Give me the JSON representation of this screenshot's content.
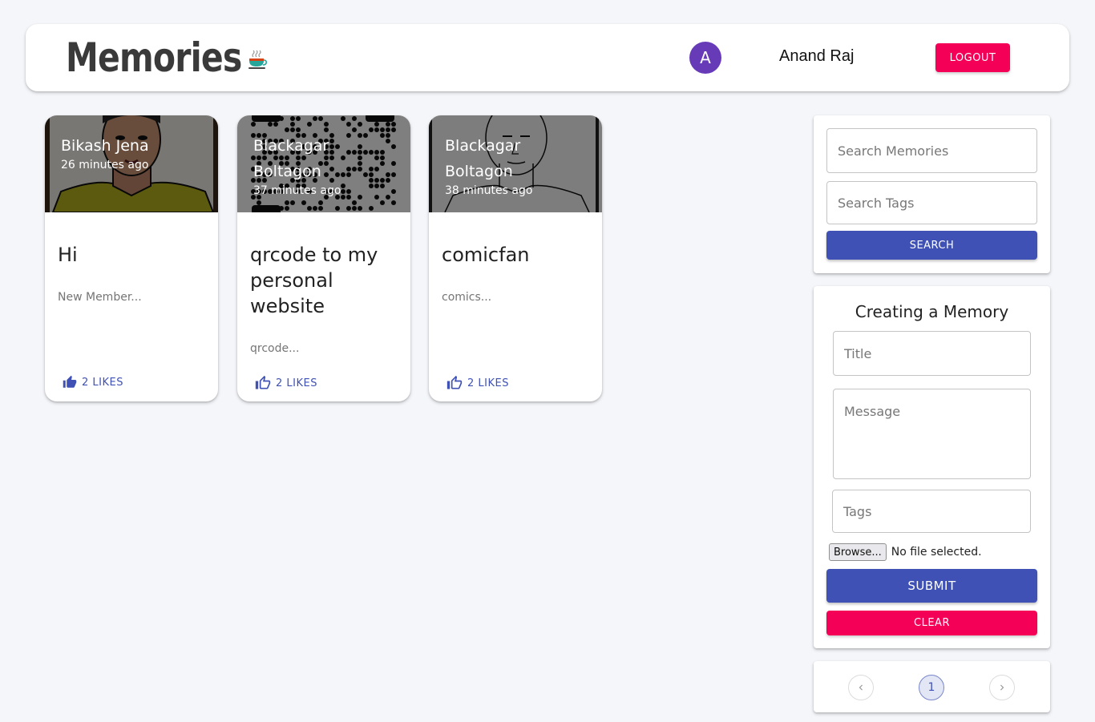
{
  "header": {
    "brand": "Memories",
    "brand_icon": "memories-mug-icon",
    "avatar_initial": "A",
    "avatar_color": "#673ab7",
    "username": "Anand Raj",
    "logout_label": "LOGOUT"
  },
  "posts": [
    {
      "creator": "Bikash Jena",
      "time": "26 minutes ago",
      "title": "Hi",
      "message": "New Member...",
      "likes": "2 LIKES",
      "image": "cartoon-portrait"
    },
    {
      "creator": "Blackagar Boltagon",
      "time": "37 minutes ago",
      "title": "qrcode to my personal website",
      "message": "qrcode...",
      "likes": "2 LIKES",
      "image": "qr-code"
    },
    {
      "creator": "Blackagar Boltagon",
      "time": "38 minutes ago",
      "title": "comicfan",
      "message": "comics...",
      "likes": "2 LIKES",
      "image": "comic-sketch"
    }
  ],
  "search": {
    "memories_placeholder": "Search Memories",
    "tags_placeholder": "Search Tags",
    "button_label": "SEARCH"
  },
  "form": {
    "heading": "Creating a Memory",
    "title_placeholder": "Title",
    "message_placeholder": "Message",
    "tags_placeholder": "Tags",
    "browse_label": "Browse...",
    "file_status": "No file selected.",
    "submit_label": "SUBMIT",
    "clear_label": "CLEAR"
  },
  "pagination": {
    "current_page": "1",
    "prev_icon": "chevron-left-icon",
    "next_icon": "chevron-right-icon"
  },
  "colors": {
    "primary": "#3f51b5",
    "secondary": "#f50057",
    "background": "#f5f6fa"
  }
}
